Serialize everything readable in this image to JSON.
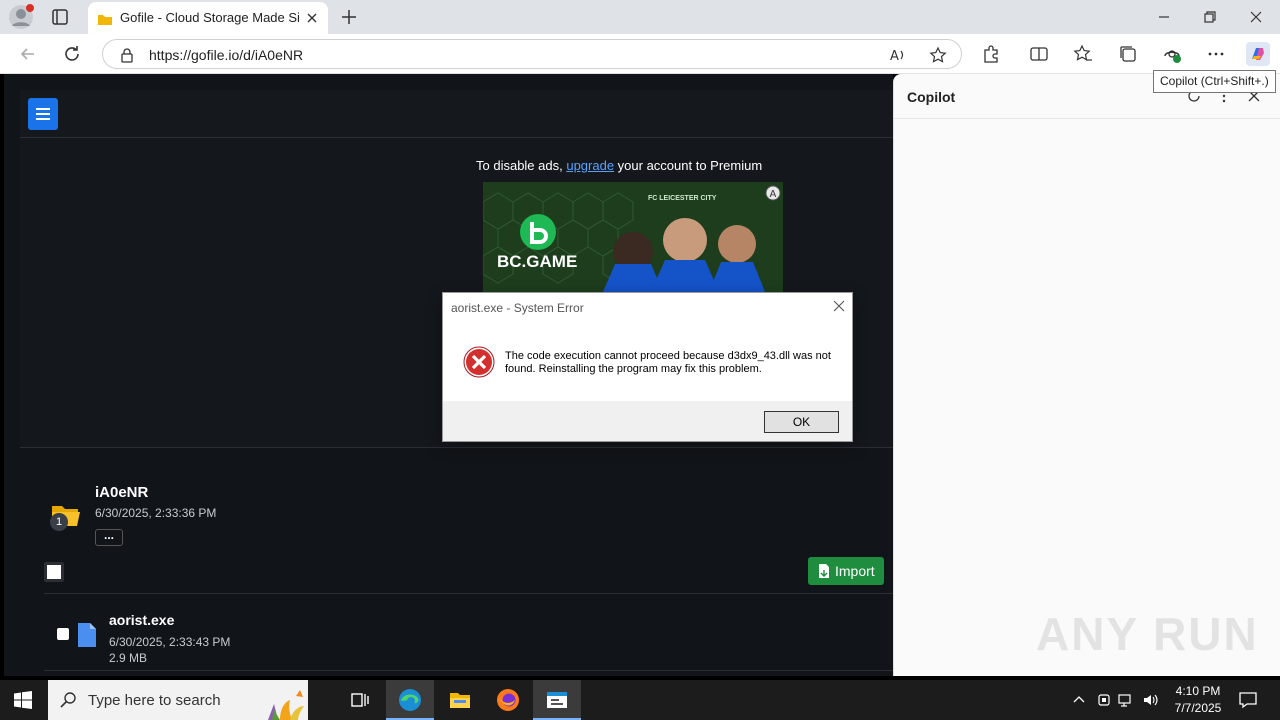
{
  "browser": {
    "tab_title": "Gofile - Cloud Storage Made Simple",
    "url": "https://gofile.io/d/iA0eNR"
  },
  "page": {
    "ad_notice_prefix": "To disable ads, ",
    "ad_notice_link": "upgrade",
    "ad_notice_suffix": " your account to Premium",
    "banner_brand": "BC.GAME",
    "banner_club": "FC LEICESTER CITY",
    "folder": {
      "name": "iA0eNR",
      "date": "6/30/2025, 2:33:36 PM",
      "count": "1",
      "more_label": "..."
    },
    "import_label": "Import",
    "files": [
      {
        "name": "aorist.exe",
        "date": "6/30/2025, 2:33:43 PM",
        "size": "2.9 MB"
      }
    ]
  },
  "copilot": {
    "title": "Copilot",
    "tooltip": "Copilot (Ctrl+Shift+.)"
  },
  "dialog": {
    "title": "aorist.exe - System Error",
    "message": "The code execution cannot proceed because d3dx9_43.dll was not found. Reinstalling the program may fix this problem.",
    "ok_label": "OK"
  },
  "taskbar": {
    "search_placeholder": "Type here to search",
    "time": "4:10 PM",
    "date": "7/7/2025"
  },
  "watermark": "ANY RUN",
  "colors": {
    "accent": "#1a73e8",
    "import": "#1e8e3e",
    "error": "#d32f2f",
    "page_bg": "#111418"
  }
}
